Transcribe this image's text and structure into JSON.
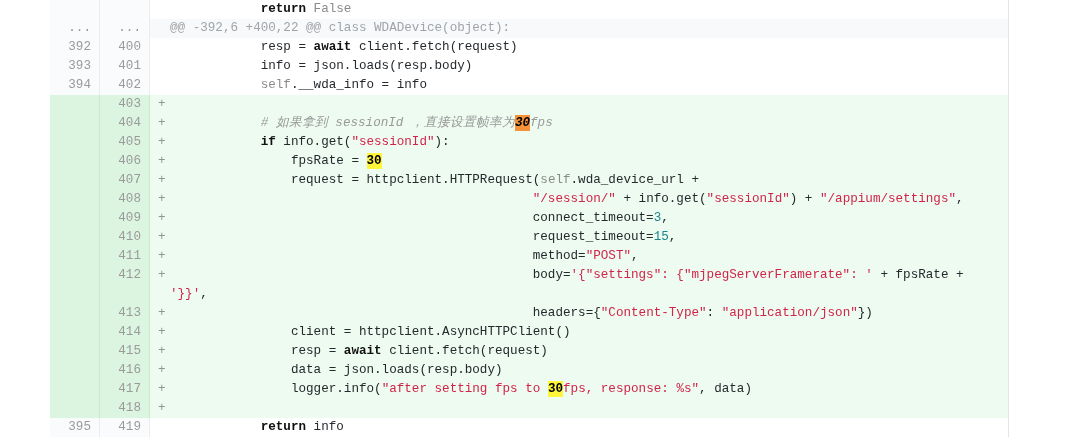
{
  "diff": {
    "rows": [
      {
        "kind": "context",
        "code": [
          {
            "t": "            return",
            "kind": "keyword"
          },
          {
            "t": " False",
            "kind": "const"
          }
        ]
      },
      {
        "kind": "hunk",
        "old": "...",
        "new": "...",
        "code": [
          {
            "t": "@@ -392,6 +400,22 @@ class WDADevice(object):",
            "kind": "plain"
          }
        ]
      },
      {
        "kind": "context",
        "old": "392",
        "new": "400",
        "code": [
          {
            "t": "            resp = ",
            "kind": "plain"
          },
          {
            "t": "await",
            "kind": "keyword"
          },
          {
            "t": " client.fetch(request)",
            "kind": "plain"
          }
        ]
      },
      {
        "kind": "context",
        "old": "393",
        "new": "401",
        "code": [
          {
            "t": "            info = json.loads(resp.body)",
            "kind": "plain"
          }
        ]
      },
      {
        "kind": "context",
        "old": "394",
        "new": "402",
        "code": [
          {
            "t": "            self",
            "kind": "const"
          },
          {
            "t": ".__wda_info = info",
            "kind": "plain"
          }
        ]
      },
      {
        "kind": "added",
        "new": "403",
        "marker": "+",
        "code": []
      },
      {
        "kind": "added",
        "new": "404",
        "marker": "+",
        "code": [
          {
            "t": "            # 如果拿到 sessionId ，直接设置帧率为",
            "kind": "comment"
          },
          {
            "t": "30",
            "kind": "match-current"
          },
          {
            "t": "fps",
            "kind": "comment"
          }
        ]
      },
      {
        "kind": "added",
        "new": "405",
        "marker": "+",
        "code": [
          {
            "t": "            if",
            "kind": "keyword"
          },
          {
            "t": " info.get(",
            "kind": "plain"
          },
          {
            "t": "\"sessionId\"",
            "kind": "string"
          },
          {
            "t": "):",
            "kind": "plain"
          }
        ]
      },
      {
        "kind": "added",
        "new": "406",
        "marker": "+",
        "code": [
          {
            "t": "                fpsRate = ",
            "kind": "plain"
          },
          {
            "t": "30",
            "kind": "match"
          }
        ]
      },
      {
        "kind": "added",
        "new": "407",
        "marker": "+",
        "code": [
          {
            "t": "                request = httpclient.HTTPRequest(",
            "kind": "plain"
          },
          {
            "t": "self",
            "kind": "const"
          },
          {
            "t": ".wda_device_url +",
            "kind": "plain"
          }
        ]
      },
      {
        "kind": "added",
        "new": "408",
        "marker": "+",
        "code": [
          {
            "t": "                                                \"/session/\"",
            "kind": "string"
          },
          {
            "t": " + info.get(",
            "kind": "plain"
          },
          {
            "t": "\"sessionId\"",
            "kind": "string"
          },
          {
            "t": ") + ",
            "kind": "plain"
          },
          {
            "t": "\"/appium/settings\"",
            "kind": "string"
          },
          {
            "t": ",",
            "kind": "plain"
          }
        ]
      },
      {
        "kind": "added",
        "new": "409",
        "marker": "+",
        "code": [
          {
            "t": "                                                connect_timeout=",
            "kind": "plain"
          },
          {
            "t": "3",
            "kind": "number"
          },
          {
            "t": ",",
            "kind": "plain"
          }
        ]
      },
      {
        "kind": "added",
        "new": "410",
        "marker": "+",
        "code": [
          {
            "t": "                                                request_timeout=",
            "kind": "plain"
          },
          {
            "t": "15",
            "kind": "number"
          },
          {
            "t": ",",
            "kind": "plain"
          }
        ]
      },
      {
        "kind": "added",
        "new": "411",
        "marker": "+",
        "code": [
          {
            "t": "                                                method=",
            "kind": "plain"
          },
          {
            "t": "\"POST\"",
            "kind": "string"
          },
          {
            "t": ",",
            "kind": "plain"
          }
        ]
      },
      {
        "kind": "added",
        "new": "412",
        "marker": "+",
        "code": [
          {
            "t": "                                                body=",
            "kind": "plain"
          },
          {
            "t": "'{\"settings\": {\"mjpegServerFramerate\": '",
            "kind": "string"
          },
          {
            "t": " + fpsRate +",
            "kind": "plain"
          }
        ]
      },
      {
        "kind": "wrap",
        "code": [
          {
            "t": "'}}'",
            "kind": "string"
          },
          {
            "t": ",",
            "kind": "plain"
          }
        ]
      },
      {
        "kind": "added",
        "new": "413",
        "marker": "+",
        "code": [
          {
            "t": "                                                headers={",
            "kind": "plain"
          },
          {
            "t": "\"Content-Type\"",
            "kind": "string"
          },
          {
            "t": ": ",
            "kind": "plain"
          },
          {
            "t": "\"application/json\"",
            "kind": "string"
          },
          {
            "t": "})",
            "kind": "plain"
          }
        ]
      },
      {
        "kind": "added",
        "new": "414",
        "marker": "+",
        "code": [
          {
            "t": "                client = httpclient.AsyncHTTPClient()",
            "kind": "plain"
          }
        ]
      },
      {
        "kind": "added",
        "new": "415",
        "marker": "+",
        "code": [
          {
            "t": "                resp = ",
            "kind": "plain"
          },
          {
            "t": "await",
            "kind": "keyword"
          },
          {
            "t": " client.fetch(request)",
            "kind": "plain"
          }
        ]
      },
      {
        "kind": "added",
        "new": "416",
        "marker": "+",
        "code": [
          {
            "t": "                data = json.loads(resp.body)",
            "kind": "plain"
          }
        ]
      },
      {
        "kind": "added",
        "new": "417",
        "marker": "+",
        "code": [
          {
            "t": "                logger.info(",
            "kind": "plain"
          },
          {
            "t": "\"after setting fps to ",
            "kind": "string"
          },
          {
            "t": "30",
            "kind": "match"
          },
          {
            "t": "fps, response: %s\"",
            "kind": "string"
          },
          {
            "t": ", data)",
            "kind": "plain"
          }
        ]
      },
      {
        "kind": "added",
        "new": "418",
        "marker": "+",
        "code": []
      },
      {
        "kind": "context",
        "old": "395",
        "new": "419",
        "code": [
          {
            "t": "            return",
            "kind": "keyword"
          },
          {
            "t": " info",
            "kind": "plain"
          }
        ]
      }
    ]
  }
}
